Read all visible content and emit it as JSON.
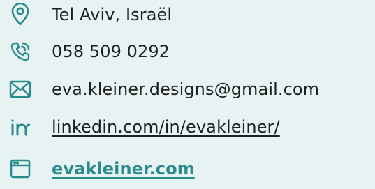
{
  "contacts": {
    "location": {
      "icon": "map-pin-icon",
      "text": "Tel Aviv, Israël"
    },
    "phone": {
      "icon": "phone-icon",
      "text": "058 509 0292"
    },
    "email": {
      "icon": "mail-icon",
      "text": "eva.kleiner.designs@gmail.com"
    },
    "linkedin": {
      "icon": "linkedin-icon",
      "text": "linkedin.com/in/evakleiner/"
    },
    "website": {
      "icon": "browser-window-icon",
      "text": "evakleiner.com"
    }
  },
  "colors": {
    "background": "#e6f3f2",
    "icon": "#2b8a8e",
    "text": "#1f1f1f",
    "accent_link": "#2b8a8e"
  }
}
